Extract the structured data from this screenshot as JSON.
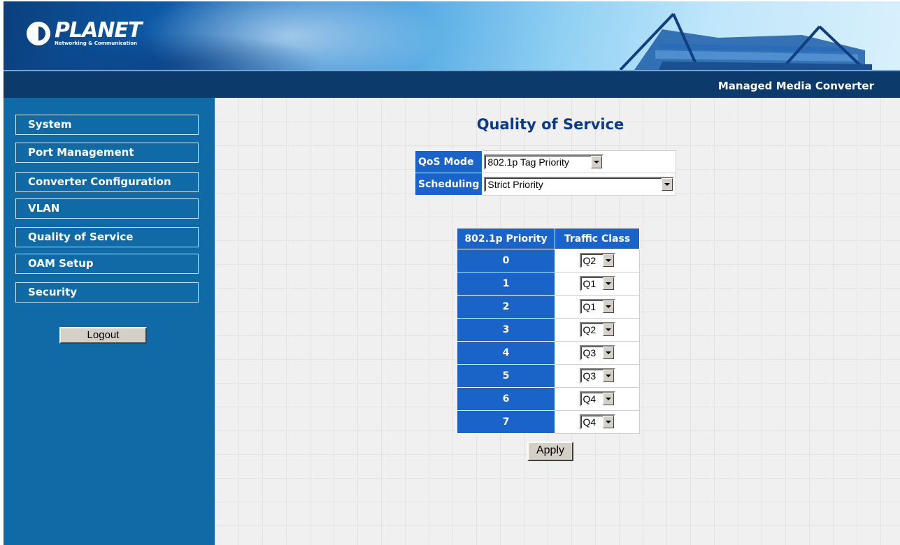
{
  "header": {
    "brand": "PLANET",
    "tagline": "Networking & Communication",
    "product": "Managed Media Converter"
  },
  "sidebar": {
    "items": [
      {
        "label": "System"
      },
      {
        "label": "Port Management"
      },
      {
        "label": "Converter Configuration"
      },
      {
        "label": "VLAN"
      },
      {
        "label": "Quality of Service"
      },
      {
        "label": "OAM Setup"
      },
      {
        "label": "Security"
      }
    ],
    "logout_label": "Logout"
  },
  "main": {
    "title": "Quality of Service",
    "qos_mode_label": "QoS Mode",
    "qos_mode_value": "802.1p Tag Priority",
    "scheduling_label": "Scheduling",
    "scheduling_value": "Strict Priority",
    "priority_header": "802.1p Priority",
    "class_header": "Traffic Class",
    "rows": [
      {
        "priority": "0",
        "class": "Q2"
      },
      {
        "priority": "1",
        "class": "Q1"
      },
      {
        "priority": "2",
        "class": "Q1"
      },
      {
        "priority": "3",
        "class": "Q2"
      },
      {
        "priority": "4",
        "class": "Q3"
      },
      {
        "priority": "5",
        "class": "Q3"
      },
      {
        "priority": "6",
        "class": "Q4"
      },
      {
        "priority": "7",
        "class": "Q4"
      }
    ],
    "apply_label": "Apply"
  },
  "colors": {
    "sidebar_bg": "#0f6aa6",
    "header_bar": "#0c3a6a",
    "table_header": "#1a63c8",
    "title_color": "#0a3a8a"
  }
}
